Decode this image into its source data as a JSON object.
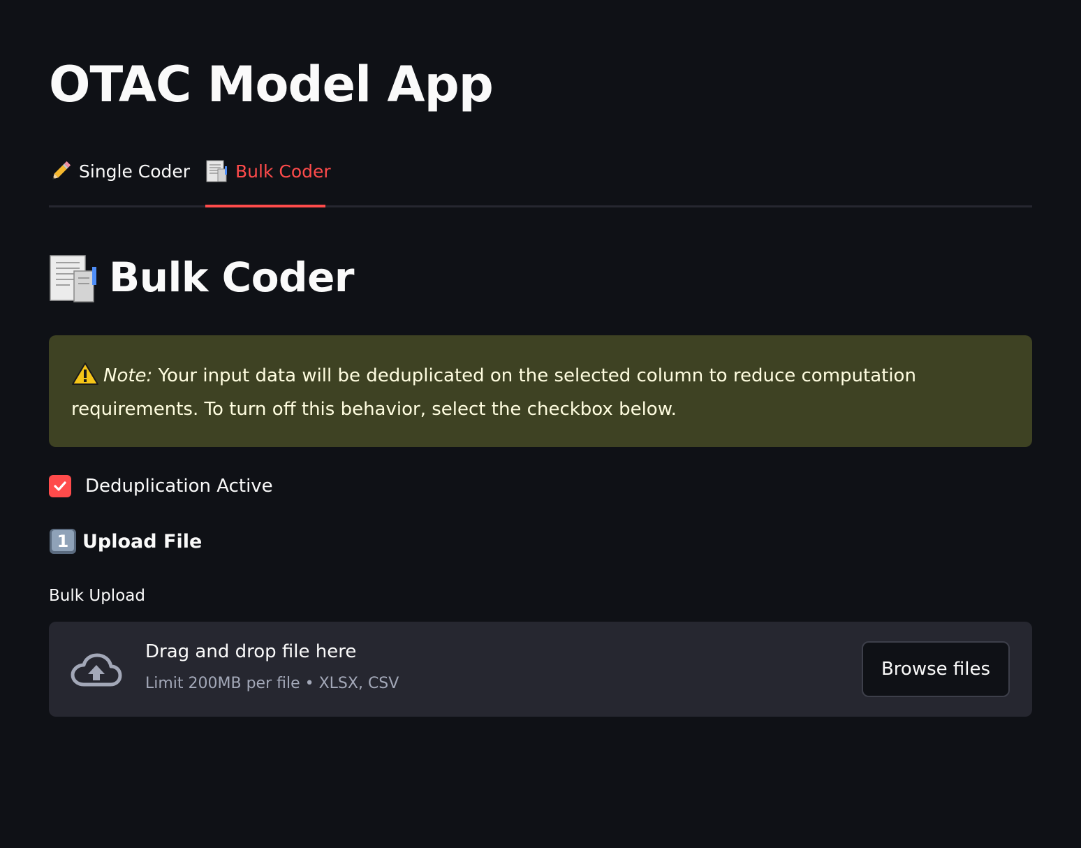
{
  "app": {
    "title": "OTAC Model App"
  },
  "tabs": [
    {
      "label": "Single Coder",
      "icon": "pencil-icon",
      "active": false
    },
    {
      "label": "Bulk Coder",
      "icon": "document-icon",
      "active": true
    }
  ],
  "section": {
    "title": "Bulk Coder",
    "icon": "document-icon"
  },
  "alert": {
    "icon": "warning-icon",
    "note_label": "Note:",
    "message": " Your input data will be deduplicated on the selected column to reduce computation requirements. To turn off this behavior, select the checkbox below."
  },
  "dedup_checkbox": {
    "label": "Deduplication Active",
    "checked": true
  },
  "upload_step": {
    "icon": "keycap-one-icon",
    "title": "Upload File"
  },
  "uploader": {
    "label": "Bulk Upload",
    "drop_title": "Drag and drop file here",
    "limit_text": "Limit 200MB per file • XLSX, CSV",
    "browse_label": "Browse files"
  },
  "colors": {
    "background": "#0f1116",
    "accent": "#ff4b4b",
    "alert_bg": "#3e4223",
    "alert_text": "#fffde0",
    "dropzone_bg": "#262730"
  }
}
